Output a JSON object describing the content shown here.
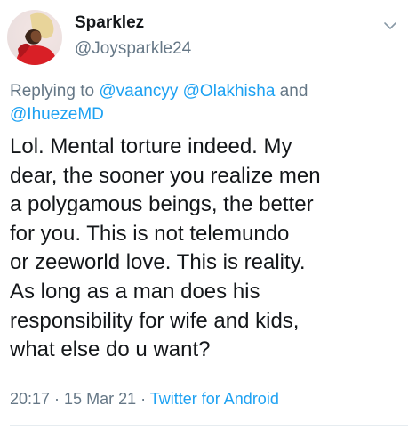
{
  "tweet": {
    "author_name": "Sparklez",
    "author_handle": "@Joysparkle24",
    "replying_to_prefix": "Replying to ",
    "mentions": [
      "@vaancyy",
      "@Olakhisha",
      "@IhuezeMD"
    ],
    "mentions_joiner": " and",
    "text_lines": [
      "Lol. Mental torture indeed. My",
      "dear, the sooner you realize men",
      "a polygamous beings, the better",
      "for you. This is not telemundo",
      "or zeeworld love. This is reality.",
      "As long as a man does his",
      "responsibility for wife and kids,",
      "what else do u want?"
    ],
    "time": "20:17",
    "date": "15 Mar 21",
    "source": "Twitter for Android",
    "separator": " · "
  },
  "icons": {
    "avatar": "profile-photo",
    "menu": "chevron-down-icon"
  },
  "colors": {
    "text_primary": "#14171a",
    "text_secondary": "#657786",
    "accent": "#1da1f2",
    "divider": "#e6ecf0"
  }
}
